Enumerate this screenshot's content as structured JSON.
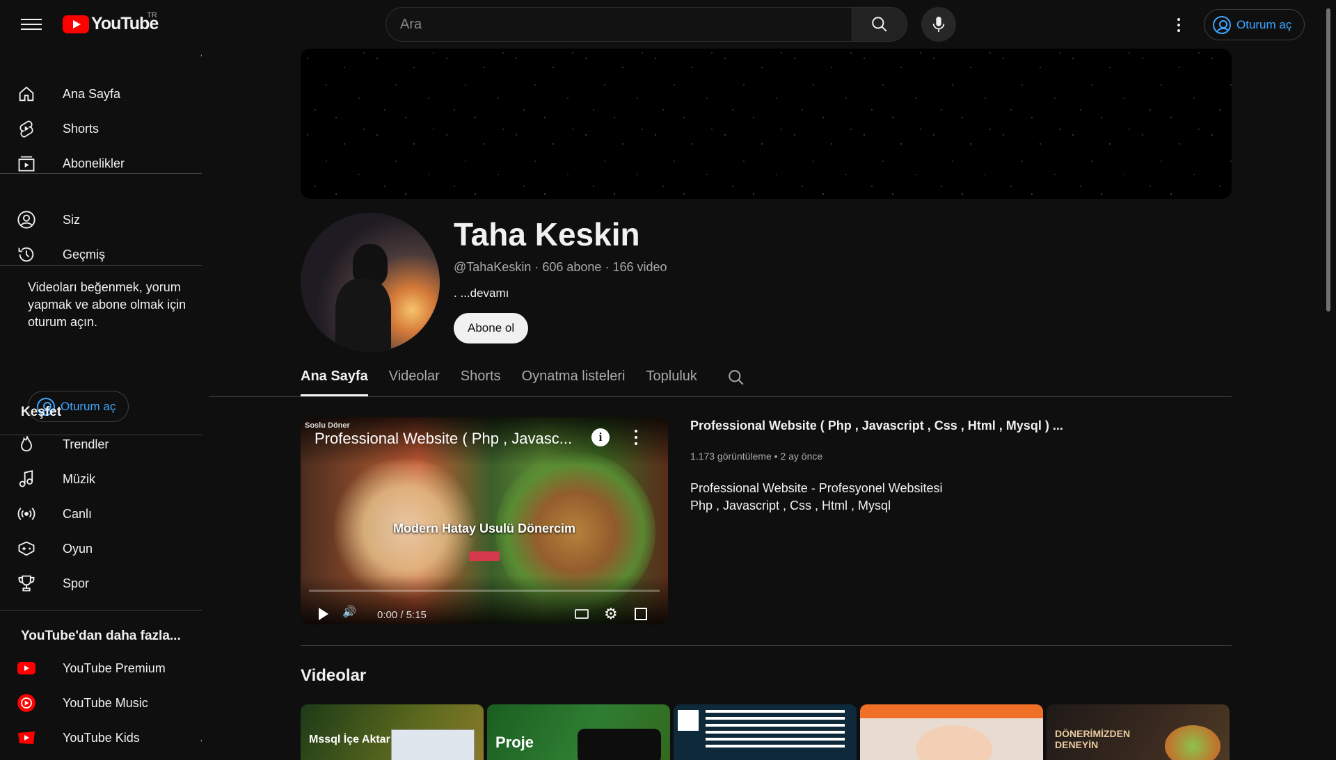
{
  "header": {
    "logo_text": "YouTube",
    "country_code": "TR",
    "search_placeholder": "Ara",
    "signin_label": "Oturum aç"
  },
  "sidebar": {
    "main": [
      {
        "label": "Ana Sayfa",
        "icon": "home-icon"
      },
      {
        "label": "Shorts",
        "icon": "shorts-icon"
      },
      {
        "label": "Abonelikler",
        "icon": "subscriptions-icon"
      }
    ],
    "you": [
      {
        "label": "Siz",
        "icon": "account-icon"
      },
      {
        "label": "Geçmiş",
        "icon": "history-icon"
      }
    ],
    "signin_prompt": "Videoları beğenmek, yorum yapmak ve abone olmak için oturum açın.",
    "signin_label": "Oturum aç",
    "explore_heading": "Keşfet",
    "explore": [
      {
        "label": "Trendler",
        "icon": "trending-icon"
      },
      {
        "label": "Müzik",
        "icon": "music-icon"
      },
      {
        "label": "Canlı",
        "icon": "live-icon"
      },
      {
        "label": "Oyun",
        "icon": "gaming-icon"
      },
      {
        "label": "Spor",
        "icon": "trophy-icon"
      }
    ],
    "more_heading": "YouTube'dan daha fazla...",
    "more": [
      {
        "label": "YouTube Premium",
        "icon": "youtube-premium-icon"
      },
      {
        "label": "YouTube Music",
        "icon": "youtube-music-icon"
      },
      {
        "label": "YouTube Kids",
        "icon": "youtube-kids-icon"
      }
    ]
  },
  "channel": {
    "name": "Taha Keskin",
    "handle": "@TahaKeskin",
    "subscribers": "606 abone",
    "videos": "166 video",
    "more": ". ...devamı",
    "subscribe_label": "Abone ol"
  },
  "tabs": [
    {
      "label": "Ana Sayfa",
      "active": true
    },
    {
      "label": "Videolar",
      "active": false
    },
    {
      "label": "Shorts",
      "active": false
    },
    {
      "label": "Oynatma listeleri",
      "active": false
    },
    {
      "label": "Topluluk",
      "active": false
    }
  ],
  "featured": {
    "player_title": "Professional Website ( Php , Javasc...",
    "player_site": "Soslu Döner",
    "player_center_text": "Modern Hatay Usulü Dönercim",
    "time": "0:00 / 5:15",
    "progress": 0,
    "title": "Professional Website ( Php , Javascript , Css , Html , Mysql ) ...",
    "views": "1.173 görüntüleme",
    "age": "2 ay önce",
    "desc_line1": "Professional Website - Profesyonel Websitesi",
    "desc_line2": "Php , Javascript , Css , Html , Mysql"
  },
  "videos_section": {
    "title": "Videolar",
    "thumbs": [
      {
        "text": "Mssql İçe Aktar"
      },
      {
        "text": "Proje"
      },
      {
        "text": ""
      },
      {
        "text": ""
      },
      {
        "text": "DÖNERİMİZDEN DENEYİN"
      }
    ]
  },
  "colors": {
    "background": "#0f0f0f",
    "brand_red": "#ff0000",
    "link_blue": "#3ea6ff"
  }
}
